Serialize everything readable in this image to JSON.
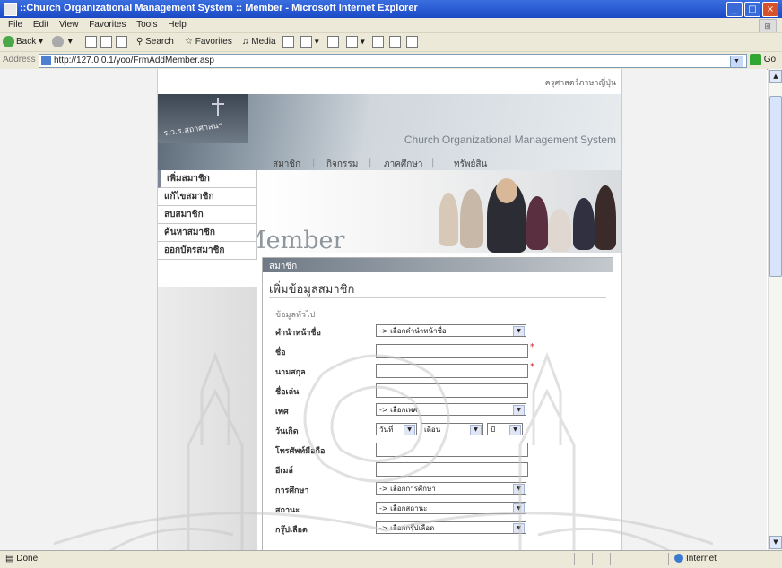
{
  "window": {
    "title": "::Church Organizational Management System :: Member - Microsoft Internet Explorer",
    "min": "_",
    "max": "□",
    "close": "×"
  },
  "menu": [
    "File",
    "Edit",
    "View",
    "Favorites",
    "Tools",
    "Help"
  ],
  "toolbar": {
    "back": "Back",
    "search": "Search",
    "favorites": "Favorites",
    "media": "Media"
  },
  "address": {
    "label": "Address",
    "url": "http://127.0.0.1/yoo/FrmAddMember.asp",
    "go": "Go"
  },
  "status": {
    "text": "Done",
    "zone": "Internet"
  },
  "site": {
    "top_link": "ครุศาสตร์ภาษาญี่ปุ่น",
    "logo_text": "ร.ว.ร.สถาศาสนา",
    "system_name": "Church Organizational Management System",
    "topnav": [
      "สมาชิก",
      "กิจกรรม",
      "ภาคศึกษา",
      "ทรัพย์สิน"
    ],
    "sidemenu": [
      "เพิ่มสมาชิก",
      "แก้ไขสมาชิก",
      "ลบสมาชิก",
      "ค้นหาสมาชิก",
      "ออกบัตรสมาชิก"
    ],
    "banner_title": "Member",
    "tab_label": "สมาชิก",
    "form_heading": "เพิ่มข้อมูลสมาชิก",
    "section_label": "ข้อมูลทั่วไป",
    "fields": {
      "prefix": {
        "label": "คำนำหน้าชื่อ",
        "value": "-> เลือกคำนำหน้าชื่อ"
      },
      "firstname": {
        "label": "ชื่อ"
      },
      "lastname": {
        "label": "นามสกุล"
      },
      "nickname": {
        "label": "ชื่อเล่น"
      },
      "gender": {
        "label": "เพศ",
        "value": "-> เลือกเพศ"
      },
      "birthdate": {
        "label": "วันเกิด",
        "day": "วันที่",
        "month": "เดือน",
        "year": "ปี"
      },
      "mobile": {
        "label": "โทรศัพท์มือถือ"
      },
      "email": {
        "label": "อีเมล์"
      },
      "education": {
        "label": "การศึกษา",
        "value": "-> เลือกการศึกษา"
      },
      "status": {
        "label": "สถานะ",
        "value": "-> เลือกสถานะ"
      },
      "bloodtype": {
        "label": "กรุ๊ปเลือด",
        "value": "-> เลือกกรุ๊ปเลือด"
      }
    },
    "required_mark": "*"
  }
}
